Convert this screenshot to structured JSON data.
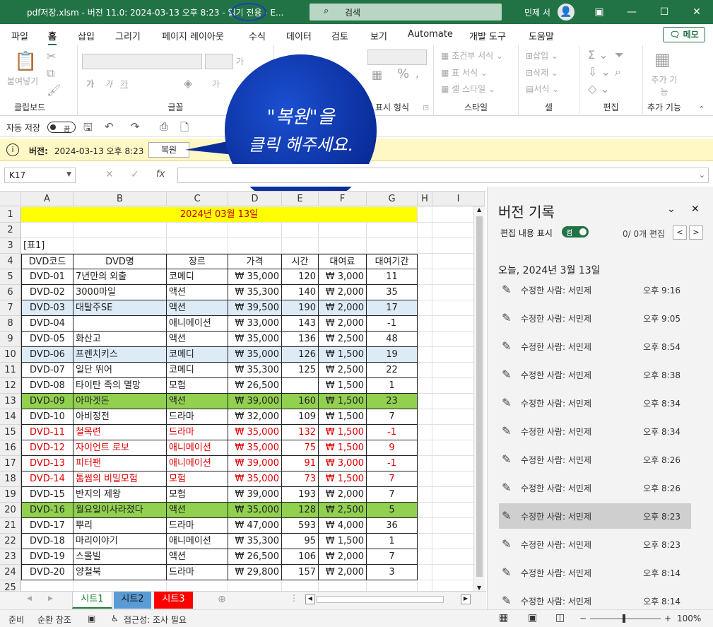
{
  "titlebar": {
    "title": "pdf저장.xlsm  -  버전 11.0: 2024-03-13 오후 8:23  -  읽기 전용  -  E...",
    "search": "검색",
    "user": "민제 서"
  },
  "menu": [
    "파일",
    "홈",
    "삽입",
    "그리기",
    "페이지 레이아웃",
    "수식",
    "데이터",
    "검토",
    "보기",
    "Automate",
    "개발 도구",
    "도움말"
  ],
  "memo_button": "메모",
  "ribbon": {
    "paste": "붙여넣기",
    "font_labels": [
      "가",
      "가",
      "가"
    ],
    "groups": [
      "클립보드",
      "글꼴",
      "표시 형식",
      "스타일",
      "셀",
      "편집",
      "추가 기능"
    ],
    "style_items": [
      "조건부 서식",
      "표 서식",
      "셀 스타일"
    ],
    "cell_items": [
      "삽입",
      "삭제",
      "서식"
    ],
    "addins": "추가 기능"
  },
  "qat": {
    "autosave": "자동 저장",
    "toggle": "끔"
  },
  "infobar": {
    "label": "버전:",
    "value": "2024-03-13 오후 8:23",
    "restore": "복원"
  },
  "callout": {
    "line1": "\"복원\"을",
    "line2": "클릭 해주세요."
  },
  "formula": {
    "namebox": "K17",
    "fx": "fx"
  },
  "sheet": {
    "columns": [
      "A",
      "B",
      "C",
      "D",
      "E",
      "F",
      "G",
      "H",
      "I"
    ],
    "row_numbers": [
      "1",
      "2",
      "3",
      "4",
      "5",
      "6",
      "7",
      "8",
      "9",
      "10",
      "11",
      "12",
      "13",
      "14",
      "15",
      "16",
      "17",
      "18",
      "19",
      "20",
      "21",
      "22",
      "23",
      "24",
      "25"
    ],
    "banner": "2024년 03월 13일",
    "table_label": "[표1]",
    "headers": [
      "DVD코드",
      "DVD명",
      "장르",
      "가격",
      "시간",
      "대여료",
      "대여기간"
    ],
    "rows": [
      [
        "DVD-01",
        "7년만의 외출",
        "코메디",
        "₩ 35,000",
        "120",
        "₩ 3,000",
        "11"
      ],
      [
        "DVD-02",
        "3000마일",
        "액션",
        "₩ 35,300",
        "140",
        "₩ 2,000",
        "35"
      ],
      [
        "DVD-03",
        "대탈주SE",
        "액션",
        "₩ 39,500",
        "190",
        "₩ 2,000",
        "17"
      ],
      [
        "DVD-04",
        "",
        "애니메이션",
        "₩ 33,000",
        "143",
        "₩ 2,000",
        "-1"
      ],
      [
        "DVD-05",
        "화산고",
        "액션",
        "₩ 35,000",
        "136",
        "₩ 2,500",
        "48"
      ],
      [
        "DVD-06",
        "프렌치키스",
        "코메디",
        "₩ 35,000",
        "126",
        "₩ 1,500",
        "19"
      ],
      [
        "DVD-07",
        "일단 뛰어",
        "코메디",
        "₩ 35,300",
        "125",
        "₩ 2,500",
        "22"
      ],
      [
        "DVD-08",
        "타이탄 족의 멸망",
        "모험",
        "₩ 26,500",
        "",
        "₩ 1,500",
        "1"
      ],
      [
        "DVD-09",
        "아마겟돈",
        "액션",
        "₩ 39,000",
        "160",
        "₩ 1,500",
        "23"
      ],
      [
        "DVD-10",
        "아비정전",
        "드라마",
        "₩ 32,000",
        "109",
        "₩ 1,500",
        "7"
      ],
      [
        "DVD-11",
        "철목련",
        "드라마",
        "₩ 35,000",
        "132",
        "₩ 1,500",
        "-1"
      ],
      [
        "DVD-12",
        "자이언트 로보",
        "애니메이션",
        "₩ 35,000",
        "75",
        "₩ 1,500",
        "9"
      ],
      [
        "DVD-13",
        "피터팬",
        "애니메이션",
        "₩ 39,000",
        "91",
        "₩ 3,000",
        "-1"
      ],
      [
        "DVD-14",
        "톰썸의 비밀모험",
        "모험",
        "₩ 35,000",
        "73",
        "₩ 1,500",
        "7"
      ],
      [
        "DVD-15",
        "반지의 제왕",
        "모험",
        "₩ 39,000",
        "193",
        "₩ 2,000",
        "7"
      ],
      [
        "DVD-16",
        "월요일이사라졌다",
        "액션",
        "₩ 35,000",
        "128",
        "₩ 2,500",
        "5"
      ],
      [
        "DVD-17",
        "뿌리",
        "드라마",
        "₩ 47,000",
        "593",
        "₩ 4,000",
        "36"
      ],
      [
        "DVD-18",
        "마리이야기",
        "애니메이션",
        "₩ 35,300",
        "95",
        "₩ 1,500",
        "1"
      ],
      [
        "DVD-19",
        "스몰빌",
        "액션",
        "₩ 26,500",
        "106",
        "₩ 2,000",
        "7"
      ],
      [
        "DVD-20",
        "양철북",
        "드라마",
        "₩ 29,800",
        "157",
        "₩ 2,000",
        "3"
      ]
    ],
    "row_styles": [
      "",
      "",
      "blue",
      "",
      "",
      "blue",
      "",
      "",
      "green",
      "",
      "red",
      "red",
      "red",
      "red",
      "",
      "green",
      "",
      "",
      "",
      ""
    ],
    "colors": {
      "banner_bg": "#ffff00",
      "banner_text": "#c00000",
      "blue": "#ddebf7",
      "green": "#92d050",
      "red": "#e00000"
    }
  },
  "sheet_tabs": [
    {
      "label": "시트1",
      "bg": "#ffffff",
      "color": "#1e7a33"
    },
    {
      "label": "시트2",
      "bg": "#5b9bd5",
      "color": "#111111"
    },
    {
      "label": "시트3",
      "bg": "#ff0000",
      "color": "#ffffff"
    }
  ],
  "status": {
    "ready": "준비",
    "circular": "순환 참조",
    "access": "접근성: 조사 필요",
    "zoom": "100%"
  },
  "version_pane": {
    "title": "버전 기록",
    "show_edits": "편집 내용 표시",
    "toggle": "켬",
    "edit_count": "0/ 0개 편집",
    "date_header": "오늘, 2024년 3월 13일",
    "entries": [
      {
        "who": "수정한 사람: 서민제",
        "time": "오후 9:16"
      },
      {
        "who": "수정한 사람: 서민제",
        "time": "오후 9:05"
      },
      {
        "who": "수정한 사람: 서민제",
        "time": "오후 8:54"
      },
      {
        "who": "수정한 사람: 서민제",
        "time": "오후 8:38"
      },
      {
        "who": "수정한 사람: 서민제",
        "time": "오후 8:34"
      },
      {
        "who": "수정한 사람: 서민제",
        "time": "오후 8:34"
      },
      {
        "who": "수정한 사람: 서민제",
        "time": "오후 8:26"
      },
      {
        "who": "수정한 사람: 서민제",
        "time": "오후 8:26"
      },
      {
        "who": "수정한 사람: 서민제",
        "time": "오후 8:23",
        "selected": true
      },
      {
        "who": "수정한 사람: 서민제",
        "time": "오후 8:23"
      },
      {
        "who": "수정한 사람: 서민제",
        "time": "오후 8:14"
      },
      {
        "who": "수정한 사람: 서민제",
        "time": "오후 8:14"
      }
    ]
  }
}
